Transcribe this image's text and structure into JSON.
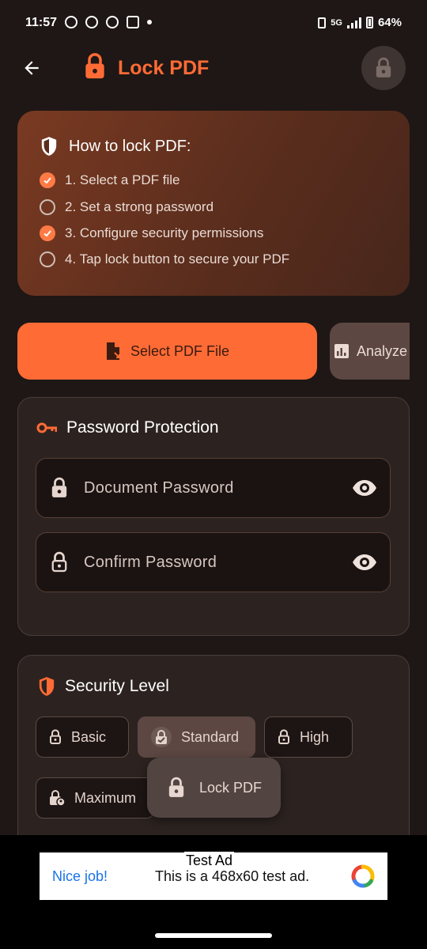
{
  "status_bar": {
    "time": "11:57",
    "network": "5G",
    "battery": "64%"
  },
  "app_bar": {
    "title": "Lock PDF"
  },
  "howto": {
    "title": "How to lock PDF:",
    "steps": [
      {
        "label": "1. Select a PDF file",
        "done": true
      },
      {
        "label": "2. Set a strong password",
        "done": false
      },
      {
        "label": "3. Configure security permissions",
        "done": true
      },
      {
        "label": "4. Tap lock button to secure your PDF",
        "done": false
      }
    ]
  },
  "actions": {
    "select_label": "Select PDF File",
    "analyze_label": "Analyze"
  },
  "password_section": {
    "title": "Password Protection",
    "document_placeholder": "Document Password",
    "confirm_placeholder": "Confirm Password"
  },
  "security_section": {
    "title": "Security Level",
    "levels": [
      "Basic",
      "Standard",
      "High",
      "Maximum"
    ],
    "selected": "Standard"
  },
  "fab": {
    "label": "Lock PDF"
  },
  "ad": {
    "tag": "Test Ad",
    "headline": "Nice job!",
    "text": "This is a 468x60 test ad."
  },
  "colors": {
    "accent": "#ff6b35",
    "background": "#1e1715",
    "card": "#2c2320"
  }
}
